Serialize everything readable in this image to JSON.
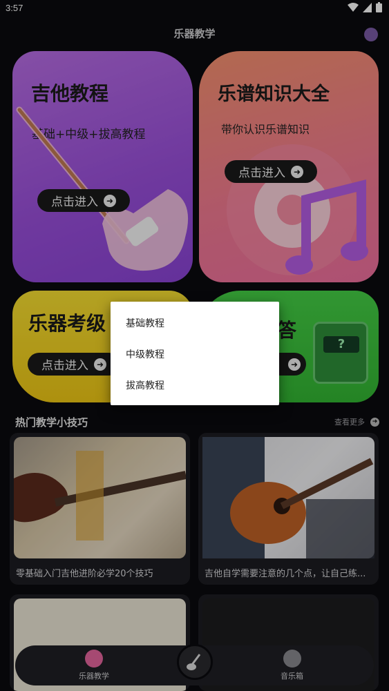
{
  "status_bar": {
    "time": "3:57"
  },
  "header": {
    "title": "乐器教学"
  },
  "cards": {
    "guitar": {
      "title": "吉他教程",
      "subtitle": "基础+中级+拔高教程",
      "button": "点击进入"
    },
    "score": {
      "title": "乐谱知识大全",
      "subtitle": "带你认识乐谱知识",
      "button": "点击进入"
    },
    "exam": {
      "title": "乐器考级",
      "button": "点击进入"
    },
    "qa": {
      "title": "答",
      "icon_text": "?"
    }
  },
  "popup_menu": {
    "items": [
      "基础教程",
      "中级教程",
      "拔高教程"
    ]
  },
  "tips_section": {
    "title": "热门教学小技巧",
    "more": "查看更多",
    "items": [
      {
        "caption": "零基础入门吉他进阶必学20个技巧"
      },
      {
        "caption": "吉他自学需要注意的几个点，让自己练..."
      }
    ]
  },
  "bottom_nav": {
    "tabs": [
      "乐器教学",
      "音乐箱"
    ]
  },
  "colors": {
    "guitar_card": "#a35be0",
    "score_card": "#f47f90",
    "exam_card": "#f4d21c",
    "qa_card": "#3ec13e"
  }
}
